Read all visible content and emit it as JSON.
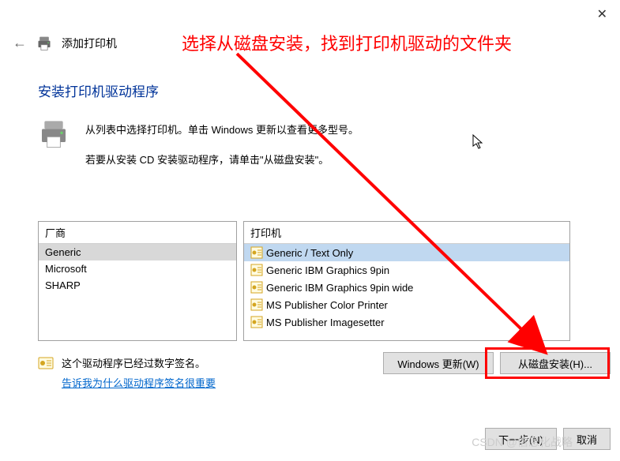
{
  "close_label": "✕",
  "back_label": "←",
  "header_title": "添加打印机",
  "annotation_text": "选择从磁盘安装，找到打印机驱动的文件夹",
  "section_title": "安装打印机驱动程序",
  "instruction1": "从列表中选择打印机。单击 Windows 更新以查看更多型号。",
  "instruction2": "若要从安装 CD 安装驱动程序，请单击\"从磁盘安装\"。",
  "manufacturers": {
    "header": "厂商",
    "items": [
      {
        "label": "Generic",
        "selected": true
      },
      {
        "label": "Microsoft",
        "selected": false
      },
      {
        "label": "SHARP",
        "selected": false
      }
    ]
  },
  "printers": {
    "header": "打印机",
    "items": [
      {
        "label": "Generic / Text Only",
        "highlighted": true
      },
      {
        "label": "Generic IBM Graphics 9pin",
        "highlighted": false
      },
      {
        "label": "Generic IBM Graphics 9pin wide",
        "highlighted": false
      },
      {
        "label": "MS Publisher Color Printer",
        "highlighted": false
      },
      {
        "label": "MS Publisher Imagesetter",
        "highlighted": false
      }
    ]
  },
  "cert_text": "这个驱动程序已经过数字签名。",
  "cert_link": "告诉我为什么驱动程序签名很重要",
  "btn_windows_update": "Windows 更新(W)",
  "btn_disk_install": "从磁盘安装(H)...",
  "btn_next": "下一步(N)",
  "btn_cancel": "取消",
  "watermark": "CSDN @信息化战略"
}
